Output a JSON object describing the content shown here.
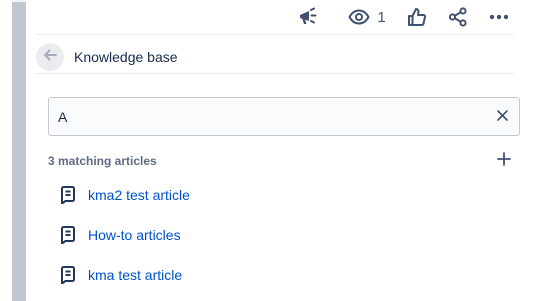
{
  "toolbar": {
    "announce_icon": "megaphone-icon",
    "watch_icon": "eye-icon",
    "watch_count": "1",
    "like_icon": "thumbs-up-icon",
    "share_icon": "share-icon",
    "more_icon": "more-horizontal-icon"
  },
  "header": {
    "back_icon": "arrow-left-icon",
    "title": "Knowledge base"
  },
  "search": {
    "value": "A",
    "clear_icon": "close-icon"
  },
  "results": {
    "count_label": "3 matching articles",
    "add_icon": "plus-icon",
    "article_icon": "page-icon",
    "articles": [
      {
        "label": "kma2 test article"
      },
      {
        "label": "How-to articles"
      },
      {
        "label": "kma test article"
      }
    ]
  },
  "colors": {
    "link": "#0052cc",
    "text": "#172b4d",
    "icon": "#42526e",
    "rail": "#c1c7d0"
  }
}
